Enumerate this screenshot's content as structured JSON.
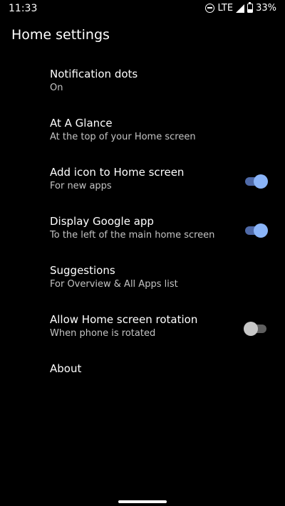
{
  "status_bar": {
    "time": "11:33",
    "network": "LTE",
    "battery": "33%",
    "battery_level": 0.33,
    "icons": [
      "do-not-disturb-icon",
      "signal-icon",
      "battery-icon"
    ]
  },
  "page": {
    "title": "Home settings"
  },
  "settings": [
    {
      "title": "Notification dots",
      "summary": "On"
    },
    {
      "title": "At A Glance",
      "summary": "At the top of your Home screen"
    },
    {
      "title": "Add icon to Home screen",
      "summary": "For new apps",
      "toggle": "on"
    },
    {
      "title": "Display Google app",
      "summary": "To the left of the main home screen",
      "toggle": "on"
    },
    {
      "title": "Suggestions",
      "summary": "For Overview & All Apps list"
    },
    {
      "title": "Allow Home screen rotation",
      "summary": "When phone is rotated",
      "toggle": "off"
    },
    {
      "title": "About"
    }
  ],
  "colors": {
    "background": "#000000",
    "toggle_on_thumb": "#8ab4f8",
    "toggle_on_track": "#4f6aa8",
    "toggle_off_thumb": "#c7c7c7",
    "toggle_off_track": "#5f5f5f"
  }
}
